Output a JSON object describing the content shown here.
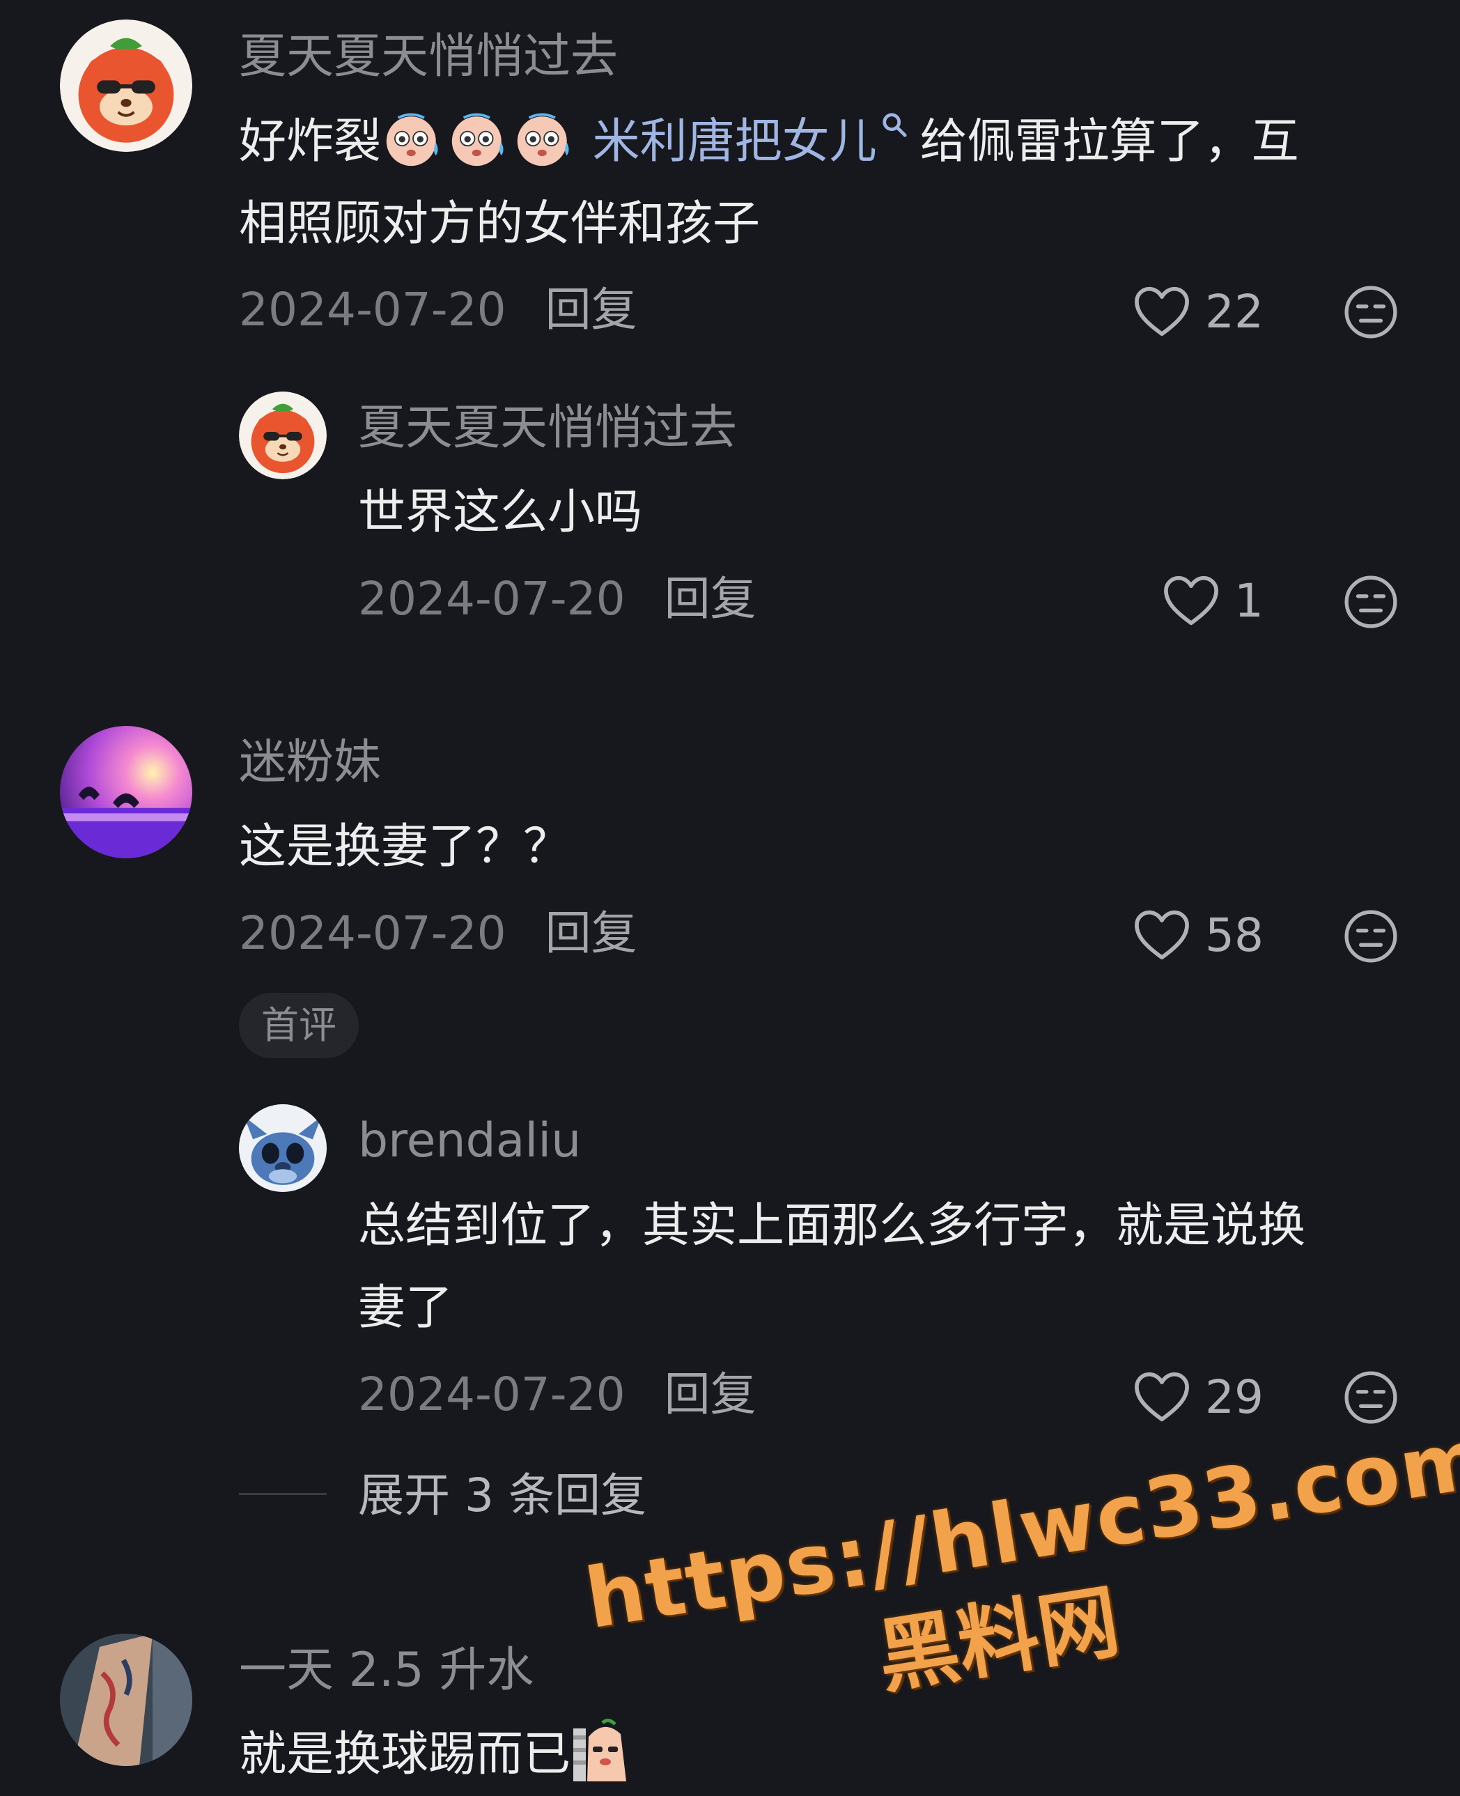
{
  "comments": [
    {
      "username": "夏天夏天悄悄过去",
      "text_line1_prefix": "好炸裂",
      "emoji": "sweat-face-emoji",
      "text_link": "米利唐把女儿",
      "text_line1_suffix": "给佩雷拉算了，互",
      "text_line2": "相照顾对方的女伴和孩子",
      "date": "2024-07-20",
      "reply_label": "回复",
      "likes": "22"
    },
    {
      "username": "夏天夏天悄悄过去",
      "text": "世界这么小吗",
      "date": "2024-07-20",
      "reply_label": "回复",
      "likes": "1"
    },
    {
      "username": "迷粉妹",
      "text": "这是换妻了？？",
      "date": "2024-07-20",
      "reply_label": "回复",
      "likes": "58",
      "badge": "首评"
    },
    {
      "username": "brendaliu",
      "text_line1": "总结到位了，其实上面那么多行字，就是说换",
      "text_line2": "妻了",
      "date": "2024-07-20",
      "reply_label": "回复",
      "likes": "29",
      "expand_label": "展开 3 条回复"
    },
    {
      "username": "一天 2.5 升水",
      "text": "就是换球踢而已"
    }
  ],
  "watermark": {
    "url": "https://hlwc33.com",
    "name": "黑料网"
  },
  "colors": {
    "background": "#17181d",
    "username": "#8c8d93",
    "text": "#eceded",
    "link": "#9fb6e3",
    "watermark": "#f2a24a"
  }
}
